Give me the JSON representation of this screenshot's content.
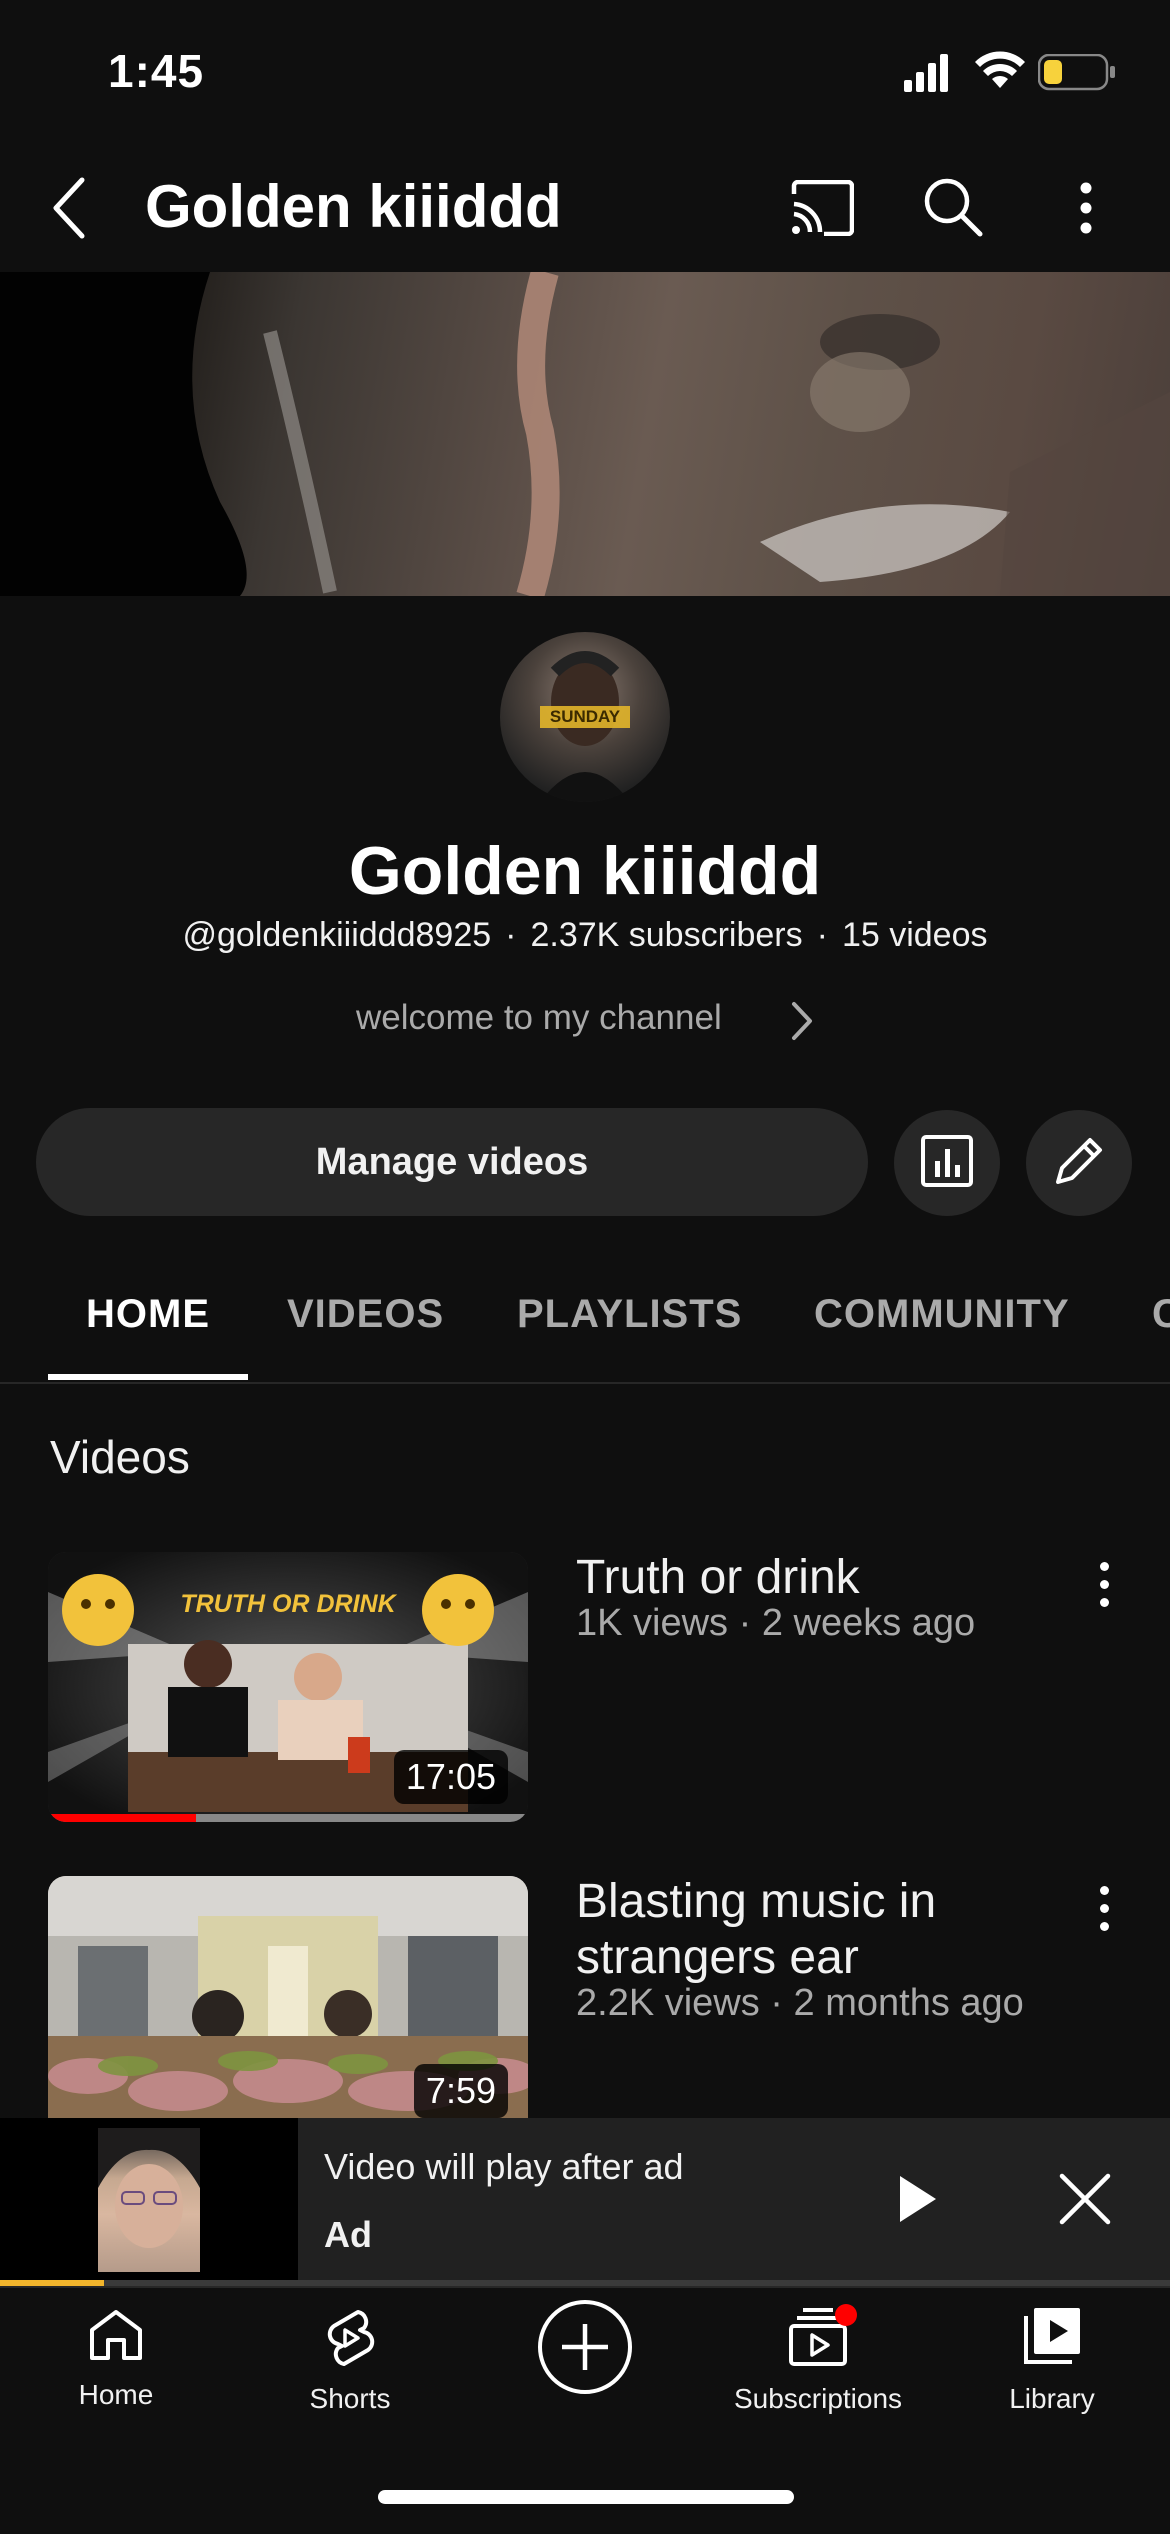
{
  "status_bar": {
    "time": "1:45"
  },
  "header": {
    "title": "Golden kiiiddd",
    "icons": [
      "back-chevron-icon",
      "cast-icon",
      "search-icon",
      "more-vert-icon"
    ]
  },
  "channel": {
    "name": "Golden kiiiddd",
    "handle": "@goldenkiiiddd8925",
    "subscribers": "2.37K subscribers",
    "videos_count": "15 videos",
    "separator": "·",
    "description": "welcome to my channel",
    "avatar_text": "SUNDAY"
  },
  "actions": {
    "manage_label": "Manage videos",
    "icons": [
      "analytics-icon",
      "edit-pencil-icon"
    ]
  },
  "tabs": [
    {
      "label": "HOME"
    },
    {
      "label": "VIDEOS"
    },
    {
      "label": "PLAYLISTS"
    },
    {
      "label": "COMMUNITY"
    },
    {
      "label": "C"
    }
  ],
  "section": {
    "title": "Videos"
  },
  "videos": [
    {
      "title": "Truth or drink",
      "meta": "1K views · 2 weeks ago",
      "duration": "17:05",
      "thumb_text": "TRUTH OR DRINK",
      "watched_fraction": 0.31
    },
    {
      "title": "Blasting music in strangers ear",
      "meta": "2.2K views · 2 months ago",
      "duration": "7:59"
    }
  ],
  "mini_player": {
    "title": "Video will play after ad",
    "label": "Ad",
    "progress_fraction": 0.09
  },
  "nav": [
    {
      "label": "Home",
      "icon": "home-icon"
    },
    {
      "label": "Shorts",
      "icon": "shorts-icon"
    },
    {
      "label": "",
      "icon": "create-plus-icon"
    },
    {
      "label": "Subscriptions",
      "icon": "subscriptions-icon"
    },
    {
      "label": "Library",
      "icon": "library-icon"
    }
  ],
  "colors": {
    "background": "#0f0f0f",
    "surface": "#272727",
    "progress_red": "#ff0000",
    "ad_yellow": "#f2b52c",
    "badge_red": "#ff0000"
  }
}
